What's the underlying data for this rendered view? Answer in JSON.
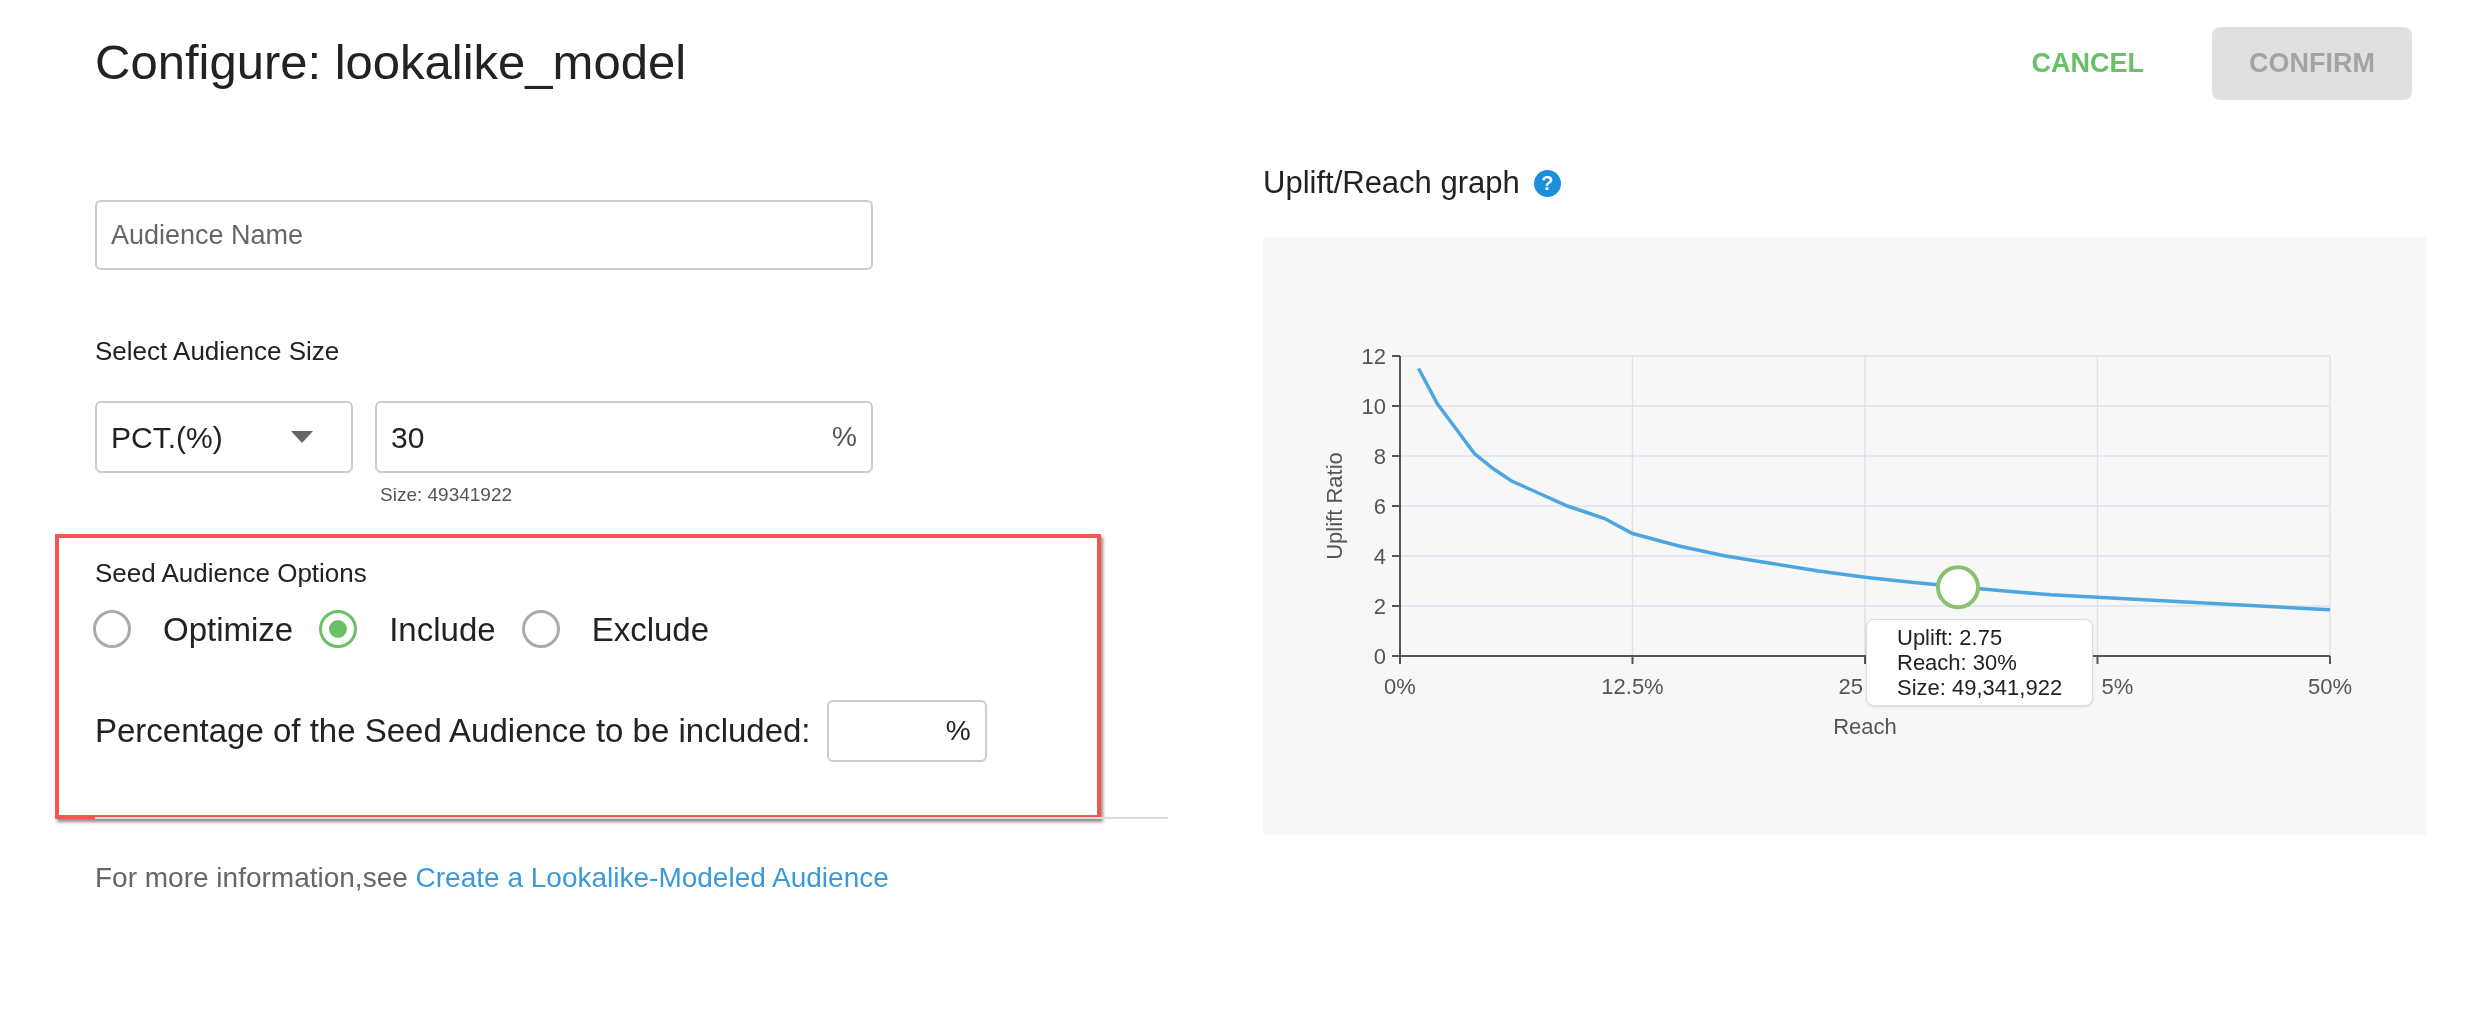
{
  "header": {
    "title": "Configure: lookalike_model",
    "buttons": [
      {
        "label": "CANCEL",
        "kind": "text",
        "disabled": false
      },
      {
        "label": "CONFIRM",
        "kind": "filled",
        "disabled": true
      }
    ]
  },
  "form": {
    "audience_name": {
      "placeholder": "Audience Name"
    },
    "size_label": "Select Audience Size",
    "size_unit": {
      "value": "PCT.(%)"
    },
    "size_value": {
      "value": "30",
      "suffix": "%"
    },
    "size_note": "Size: 49341922",
    "seed": {
      "title": "Seed Audience Options",
      "options": [
        {
          "label": "Optimize",
          "selected": false
        },
        {
          "label": "Include",
          "selected": true
        },
        {
          "label": "Exclude",
          "selected": false
        }
      ],
      "percentage": {
        "label": "Percentage of the Seed Audience to be included:",
        "suffix": "%"
      }
    },
    "footer": {
      "text": "For more information,see",
      "link": "Create a Lookalike-Modeled Audience"
    }
  },
  "graph": {
    "title": "Uplift/Reach graph",
    "help_icon": "?",
    "covered_tick_labels": [
      "25",
      "5%"
    ],
    "chart_data": {
      "type": "line",
      "xlabel": "Reach",
      "ylabel": "Uplift Ratio",
      "x": [
        1,
        2,
        3,
        4,
        5,
        6,
        7.5,
        9,
        10,
        11,
        12.5,
        15,
        17.5,
        20,
        22.5,
        25,
        27.5,
        32.5,
        35,
        37.5,
        40,
        45,
        50
      ],
      "series": [
        {
          "color": "#4ea6e0",
          "values": [
            11.5,
            10.1,
            9.1,
            8.1,
            7.5,
            7.0,
            6.5,
            6.0,
            5.75,
            5.5,
            4.9,
            4.4,
            4.0,
            3.7,
            3.4,
            3.15,
            2.95,
            2.6,
            2.45,
            2.35,
            2.25,
            2.05,
            1.85
          ]
        }
      ],
      "grid": true,
      "xlim": [
        0,
        50
      ],
      "ylim": [
        0,
        12
      ],
      "xticks": [
        {
          "value": 0,
          "label": "0%"
        },
        {
          "value": 12.5,
          "label": "12.5%"
        },
        {
          "value": 50,
          "label": "50%"
        }
      ],
      "yticks": [
        0,
        2,
        4,
        6,
        8,
        10,
        12
      ],
      "annotations": [
        {
          "x": 30,
          "y": 2.75,
          "text": "Uplift: 2.75\nReach: 30%\nSize: 49,341,922"
        }
      ]
    }
  }
}
